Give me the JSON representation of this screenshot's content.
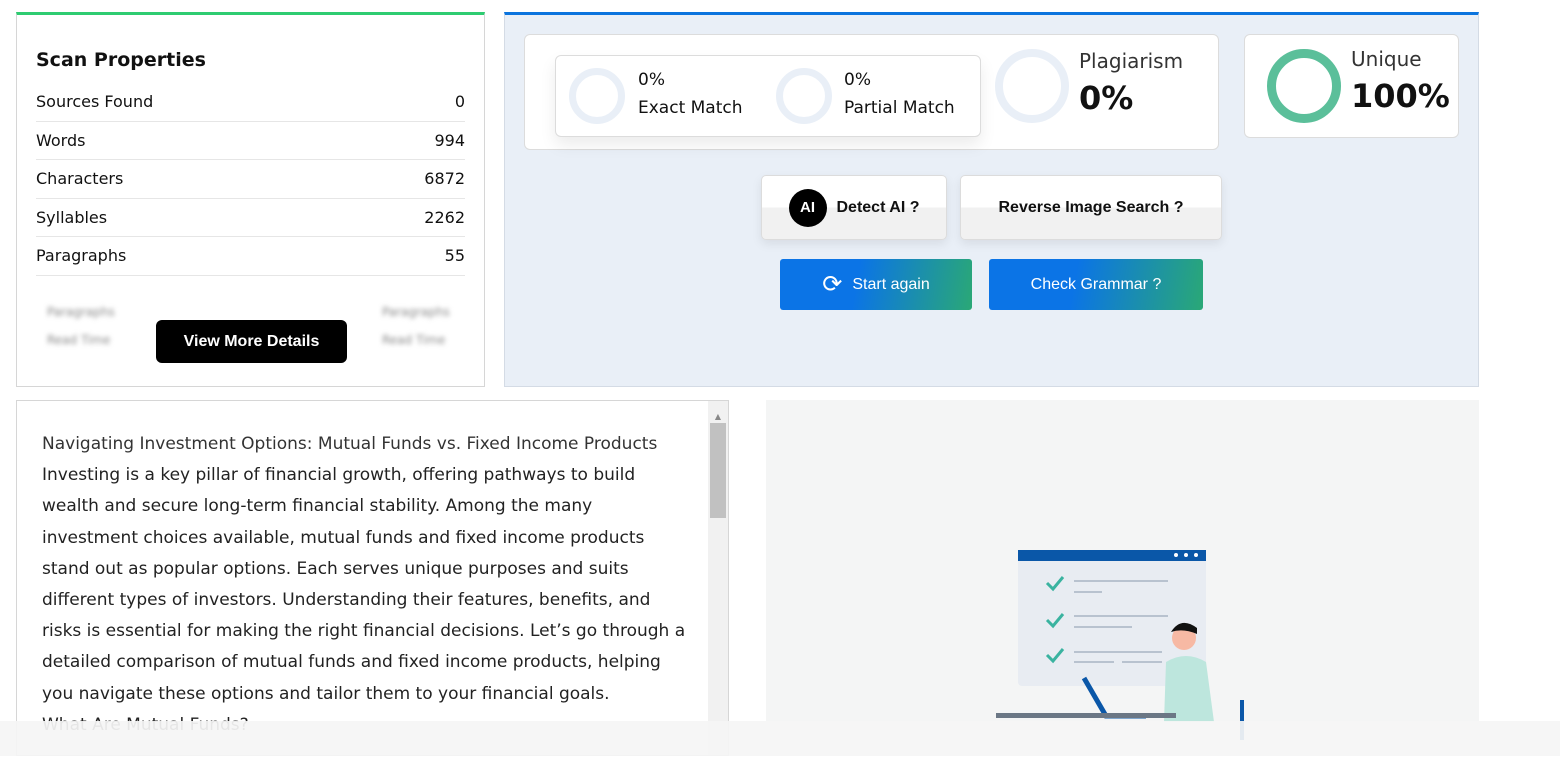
{
  "scan_properties": {
    "title": "Scan Properties",
    "rows": [
      {
        "label": "Sources Found",
        "value": "0"
      },
      {
        "label": "Words",
        "value": "994"
      },
      {
        "label": "Characters",
        "value": "6872"
      },
      {
        "label": "Syllables",
        "value": "2262"
      },
      {
        "label": "Paragraphs",
        "value": "55"
      }
    ],
    "blurred": [
      "Paragraphs",
      "Read Time",
      "Paragraphs",
      "Read Time"
    ],
    "view_more": "View More Details"
  },
  "results": {
    "exact": {
      "value": "0%",
      "label": "Exact Match"
    },
    "partial": {
      "value": "0%",
      "label": "Partial Match"
    },
    "plagiarism": {
      "label": "Plagiarism",
      "value": "0%"
    },
    "unique": {
      "label": "Unique",
      "value": "100%",
      "percent": 100,
      "color": "#5bbf9a"
    },
    "detect_ai": "Detect AI ?",
    "ai_badge": "AI",
    "reverse_image": "Reverse Image Search ?",
    "start_again": "Start again",
    "check_grammar": "Check Grammar ?"
  },
  "document": {
    "paragraphs": [
      "Navigating Investment Options: Mutual Funds vs. Fixed Income Products",
      "Investing is a key pillar of financial growth, offering pathways to build wealth and secure long-term financial stability. Among the many investment choices available, mutual funds and fixed income products stand out as popular options. Each serves unique purposes and suits different types of investors. Understanding their features, benefits, and risks is essential for making the right financial decisions. Let’s go through a detailed comparison of mutual funds and fixed income products, helping you navigate these options and tailor them to your financial goals.",
      "What Are Mutual Funds?"
    ]
  }
}
